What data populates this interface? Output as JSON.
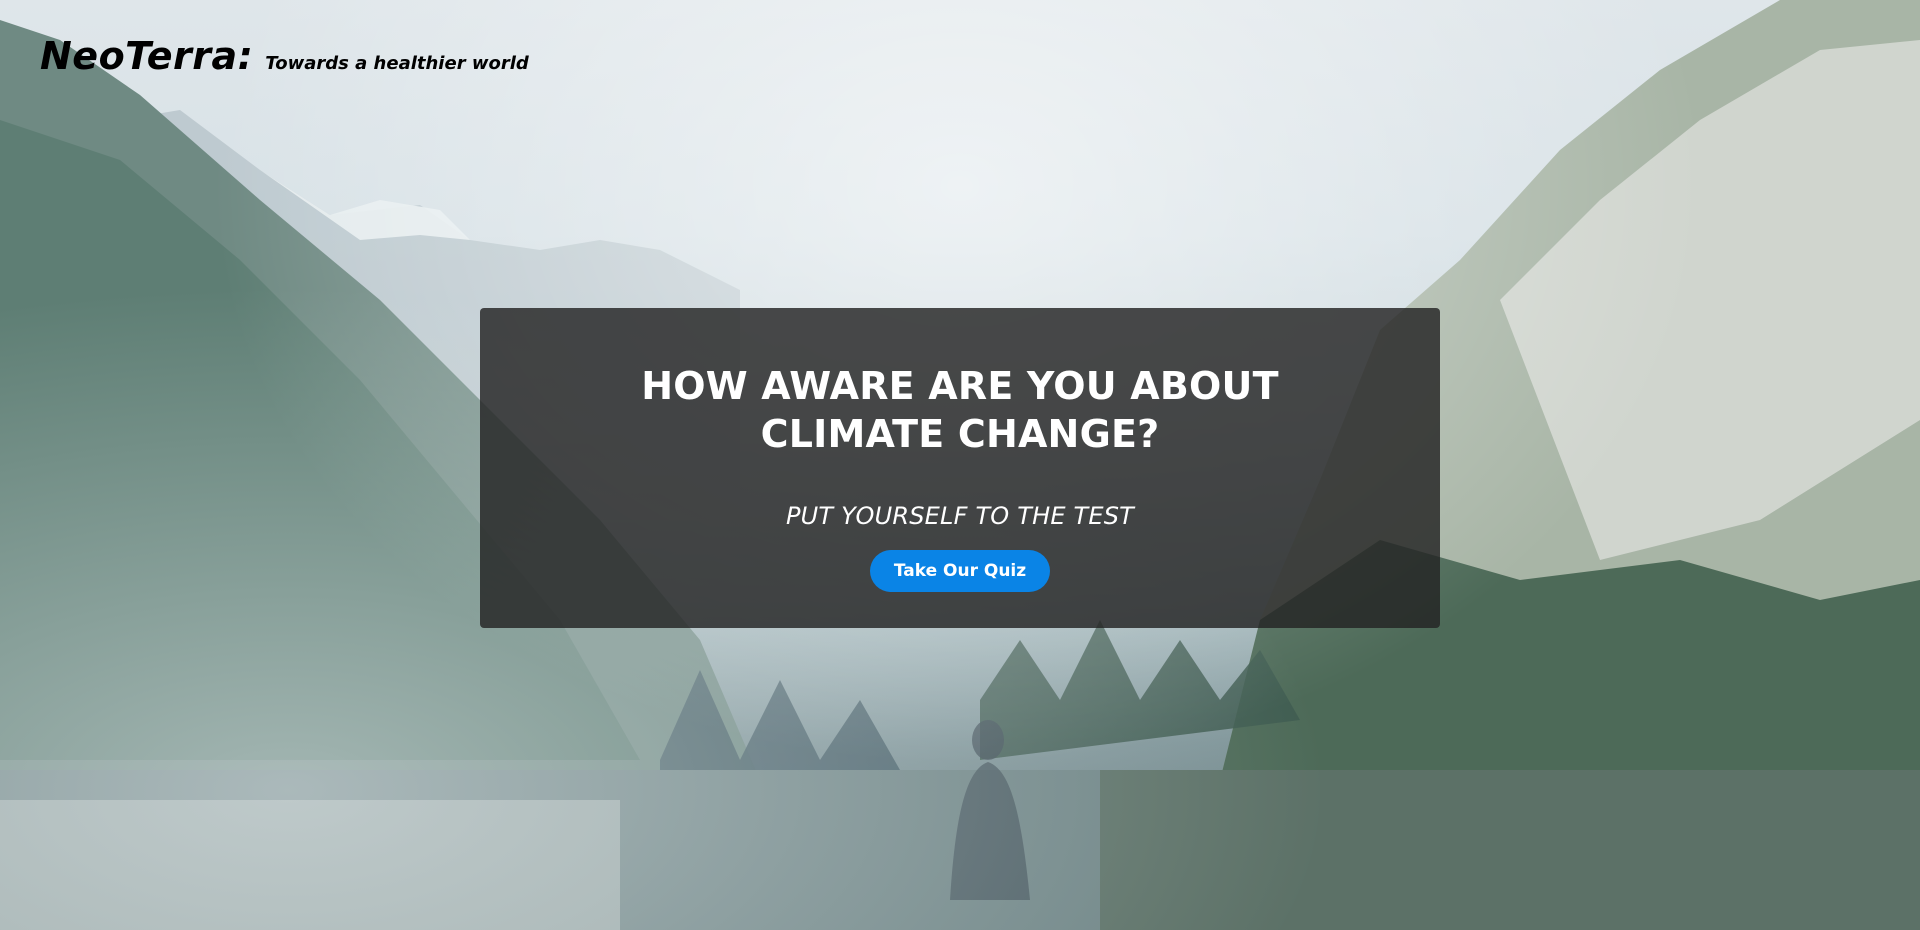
{
  "header": {
    "brand_name": "NeoTerra:",
    "tagline": "Towards a healthier world"
  },
  "hero": {
    "title": "HOW AWARE ARE YOU ABOUT CLIMATE CHANGE?",
    "subtitle": "PUT YOURSELF TO THE TEST",
    "cta_label": "Take Our Quiz"
  },
  "colors": {
    "card_background": "#232323",
    "button_background": "#0a84e6",
    "brand_text": "#000000",
    "card_text": "#ffffff"
  },
  "background": {
    "icon": "mountain-lake-landscape-image"
  }
}
